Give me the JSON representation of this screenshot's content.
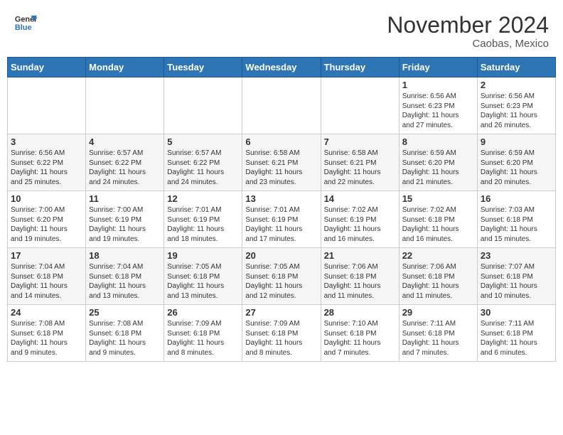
{
  "header": {
    "logo_line1": "General",
    "logo_line2": "Blue",
    "month": "November 2024",
    "location": "Caobas, Mexico"
  },
  "weekdays": [
    "Sunday",
    "Monday",
    "Tuesday",
    "Wednesday",
    "Thursday",
    "Friday",
    "Saturday"
  ],
  "weeks": [
    [
      {
        "day": "",
        "info": ""
      },
      {
        "day": "",
        "info": ""
      },
      {
        "day": "",
        "info": ""
      },
      {
        "day": "",
        "info": ""
      },
      {
        "day": "",
        "info": ""
      },
      {
        "day": "1",
        "info": "Sunrise: 6:56 AM\nSunset: 6:23 PM\nDaylight: 11 hours\nand 27 minutes."
      },
      {
        "day": "2",
        "info": "Sunrise: 6:56 AM\nSunset: 6:23 PM\nDaylight: 11 hours\nand 26 minutes."
      }
    ],
    [
      {
        "day": "3",
        "info": "Sunrise: 6:56 AM\nSunset: 6:22 PM\nDaylight: 11 hours\nand 25 minutes."
      },
      {
        "day": "4",
        "info": "Sunrise: 6:57 AM\nSunset: 6:22 PM\nDaylight: 11 hours\nand 24 minutes."
      },
      {
        "day": "5",
        "info": "Sunrise: 6:57 AM\nSunset: 6:22 PM\nDaylight: 11 hours\nand 24 minutes."
      },
      {
        "day": "6",
        "info": "Sunrise: 6:58 AM\nSunset: 6:21 PM\nDaylight: 11 hours\nand 23 minutes."
      },
      {
        "day": "7",
        "info": "Sunrise: 6:58 AM\nSunset: 6:21 PM\nDaylight: 11 hours\nand 22 minutes."
      },
      {
        "day": "8",
        "info": "Sunrise: 6:59 AM\nSunset: 6:20 PM\nDaylight: 11 hours\nand 21 minutes."
      },
      {
        "day": "9",
        "info": "Sunrise: 6:59 AM\nSunset: 6:20 PM\nDaylight: 11 hours\nand 20 minutes."
      }
    ],
    [
      {
        "day": "10",
        "info": "Sunrise: 7:00 AM\nSunset: 6:20 PM\nDaylight: 11 hours\nand 19 minutes."
      },
      {
        "day": "11",
        "info": "Sunrise: 7:00 AM\nSunset: 6:19 PM\nDaylight: 11 hours\nand 19 minutes."
      },
      {
        "day": "12",
        "info": "Sunrise: 7:01 AM\nSunset: 6:19 PM\nDaylight: 11 hours\nand 18 minutes."
      },
      {
        "day": "13",
        "info": "Sunrise: 7:01 AM\nSunset: 6:19 PM\nDaylight: 11 hours\nand 17 minutes."
      },
      {
        "day": "14",
        "info": "Sunrise: 7:02 AM\nSunset: 6:19 PM\nDaylight: 11 hours\nand 16 minutes."
      },
      {
        "day": "15",
        "info": "Sunrise: 7:02 AM\nSunset: 6:18 PM\nDaylight: 11 hours\nand 16 minutes."
      },
      {
        "day": "16",
        "info": "Sunrise: 7:03 AM\nSunset: 6:18 PM\nDaylight: 11 hours\nand 15 minutes."
      }
    ],
    [
      {
        "day": "17",
        "info": "Sunrise: 7:04 AM\nSunset: 6:18 PM\nDaylight: 11 hours\nand 14 minutes."
      },
      {
        "day": "18",
        "info": "Sunrise: 7:04 AM\nSunset: 6:18 PM\nDaylight: 11 hours\nand 13 minutes."
      },
      {
        "day": "19",
        "info": "Sunrise: 7:05 AM\nSunset: 6:18 PM\nDaylight: 11 hours\nand 13 minutes."
      },
      {
        "day": "20",
        "info": "Sunrise: 7:05 AM\nSunset: 6:18 PM\nDaylight: 11 hours\nand 12 minutes."
      },
      {
        "day": "21",
        "info": "Sunrise: 7:06 AM\nSunset: 6:18 PM\nDaylight: 11 hours\nand 11 minutes."
      },
      {
        "day": "22",
        "info": "Sunrise: 7:06 AM\nSunset: 6:18 PM\nDaylight: 11 hours\nand 11 minutes."
      },
      {
        "day": "23",
        "info": "Sunrise: 7:07 AM\nSunset: 6:18 PM\nDaylight: 11 hours\nand 10 minutes."
      }
    ],
    [
      {
        "day": "24",
        "info": "Sunrise: 7:08 AM\nSunset: 6:18 PM\nDaylight: 11 hours\nand 9 minutes."
      },
      {
        "day": "25",
        "info": "Sunrise: 7:08 AM\nSunset: 6:18 PM\nDaylight: 11 hours\nand 9 minutes."
      },
      {
        "day": "26",
        "info": "Sunrise: 7:09 AM\nSunset: 6:18 PM\nDaylight: 11 hours\nand 8 minutes."
      },
      {
        "day": "27",
        "info": "Sunrise: 7:09 AM\nSunset: 6:18 PM\nDaylight: 11 hours\nand 8 minutes."
      },
      {
        "day": "28",
        "info": "Sunrise: 7:10 AM\nSunset: 6:18 PM\nDaylight: 11 hours\nand 7 minutes."
      },
      {
        "day": "29",
        "info": "Sunrise: 7:11 AM\nSunset: 6:18 PM\nDaylight: 11 hours\nand 7 minutes."
      },
      {
        "day": "30",
        "info": "Sunrise: 7:11 AM\nSunset: 6:18 PM\nDaylight: 11 hours\nand 6 minutes."
      }
    ]
  ]
}
